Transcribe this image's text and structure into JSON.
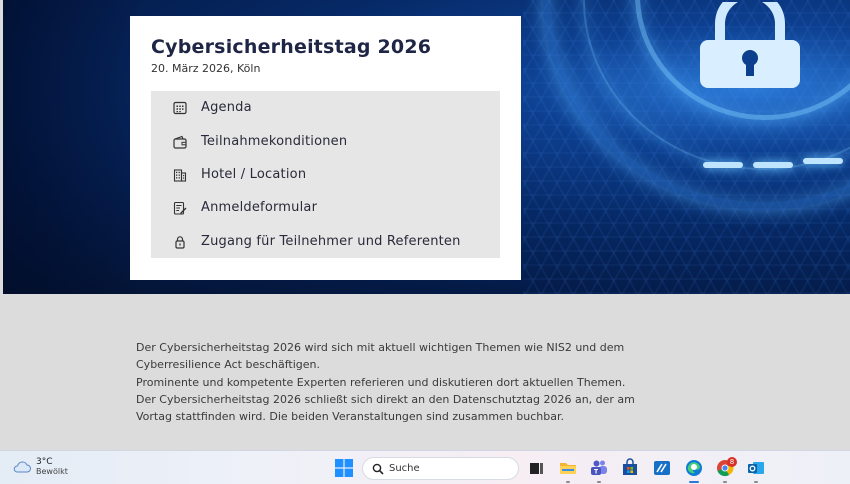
{
  "event": {
    "title": "Cybersicherheitstag 2026",
    "date_location": "20. März 2026, Köln"
  },
  "menu": [
    {
      "label": "Agenda",
      "icon": "calendar-icon"
    },
    {
      "label": "Teilnahmekonditionen",
      "icon": "wallet-icon"
    },
    {
      "label": "Hotel / Location",
      "icon": "building-icon"
    },
    {
      "label": "Anmeldeformular",
      "icon": "form-edit-icon"
    },
    {
      "label": "Zugang für Teilnehmer und Referenten",
      "icon": "lock-icon"
    }
  ],
  "description": [
    "Der Cybersicherheitstag 2026 wird sich mit aktuell wichtigen Themen wie NIS2 und dem",
    "Cyberresilience Act beschäftigen.",
    "Prominente und kompetente Experten referieren und diskutieren dort aktuellen Themen.",
    "Der Cybersicherheitstag 2026 schließt sich direkt an den Datenschutztag 2026 an, der am",
    "Vortag stattfinden wird. Die beiden Veranstaltungen sind zusammen buchbar."
  ],
  "taskbar": {
    "weather_temp": "3°C",
    "weather_condition": "Bewölkt",
    "search_placeholder": "Suche",
    "chrome_badge": "8",
    "apps": [
      "task-view",
      "file-explorer",
      "teams",
      "microsoft-store",
      "remote-desktop",
      "edge",
      "chrome",
      "outlook"
    ]
  },
  "colors": {
    "title": "#1f2545",
    "hero_dark": "#041a46",
    "accent_blue": "#2b7ad8",
    "menu_bg": "#e6e6e6"
  }
}
